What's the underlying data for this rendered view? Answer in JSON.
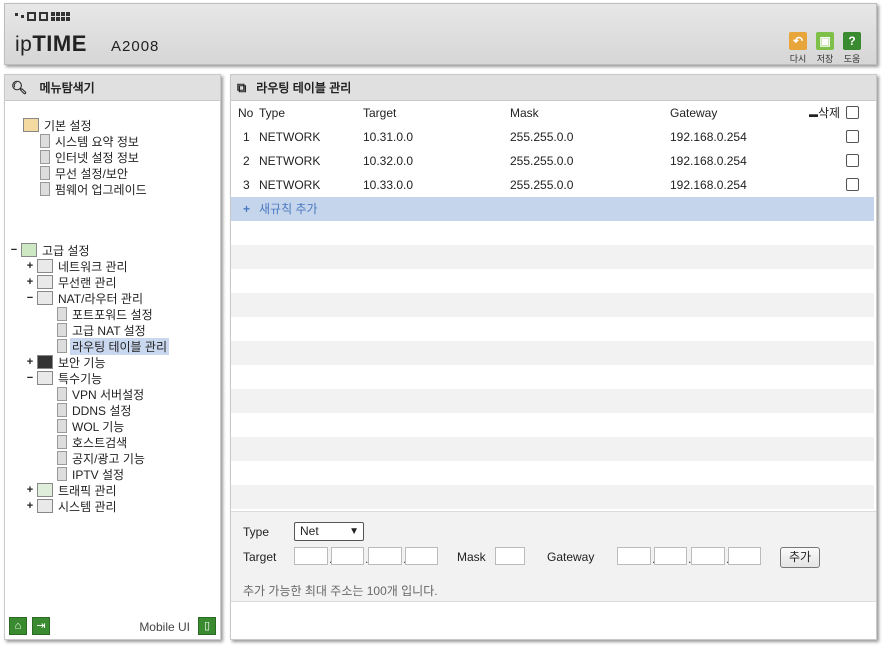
{
  "header": {
    "brand_prefix": "ip",
    "brand_bold": "TIME",
    "model": "A2008",
    "buttons": [
      {
        "label": "다시",
        "icon": "undo-icon",
        "color": "#e8a53a"
      },
      {
        "label": "저장",
        "icon": "save-icon",
        "color": "#7fc04a"
      },
      {
        "label": "도움",
        "icon": "help-icon",
        "color": "#3a8a2f"
      }
    ]
  },
  "sidebar": {
    "title": "메뉴탐색기",
    "basic": {
      "label": "기본 설정",
      "items": [
        "시스템 요약 정보",
        "인터넷 설정 정보",
        "무선 설정/보안",
        "펌웨어 업그레이드"
      ]
    },
    "advanced": {
      "label": "고급 설정",
      "items": [
        {
          "label": "네트워크 관리",
          "toggle": "+"
        },
        {
          "label": "무선랜 관리",
          "toggle": "+"
        },
        {
          "label": "NAT/라우터 관리",
          "toggle": "−"
        },
        {
          "label": "포트포워드 설정",
          "toggle": ""
        },
        {
          "label": "고급 NAT 설정",
          "toggle": ""
        },
        {
          "label": "라우팅 테이블 관리",
          "toggle": "",
          "selected": true
        },
        {
          "label": "보안 기능",
          "toggle": "+"
        },
        {
          "label": "특수기능",
          "toggle": "−"
        },
        {
          "label": "VPN 서버설정",
          "toggle": ""
        },
        {
          "label": "DDNS 설정",
          "toggle": ""
        },
        {
          "label": "WOL 기능",
          "toggle": ""
        },
        {
          "label": "호스트검색",
          "toggle": ""
        },
        {
          "label": "공지/광고 기능",
          "toggle": ""
        },
        {
          "label": "IPTV 설정",
          "toggle": ""
        },
        {
          "label": "트래픽 관리",
          "toggle": "+"
        },
        {
          "label": "시스템 관리",
          "toggle": "+"
        }
      ]
    },
    "mobile_label": "Mobile UI"
  },
  "main": {
    "title": "라우팅 테이블 관리",
    "columns": {
      "no": "No",
      "type": "Type",
      "target": "Target",
      "mask": "Mask",
      "gateway": "Gateway",
      "delete": "삭제"
    },
    "rows": [
      {
        "no": "1",
        "type": "NETWORK",
        "target": "10.31.0.0",
        "mask": "255.255.0.0",
        "gateway": "192.168.0.254"
      },
      {
        "no": "2",
        "type": "NETWORK",
        "target": "10.32.0.0",
        "mask": "255.255.0.0",
        "gateway": "192.168.0.254"
      },
      {
        "no": "3",
        "type": "NETWORK",
        "target": "10.33.0.0",
        "mask": "255.255.0.0",
        "gateway": "192.168.0.254"
      }
    ],
    "add_rule": "새규칙 추가",
    "form": {
      "type_label": "Type",
      "type_value": "Net",
      "target_label": "Target",
      "mask_label": "Mask",
      "gateway_label": "Gateway",
      "add_button": "추가",
      "note": "추가 가능한 최대 주소는 100개 입니다."
    }
  }
}
